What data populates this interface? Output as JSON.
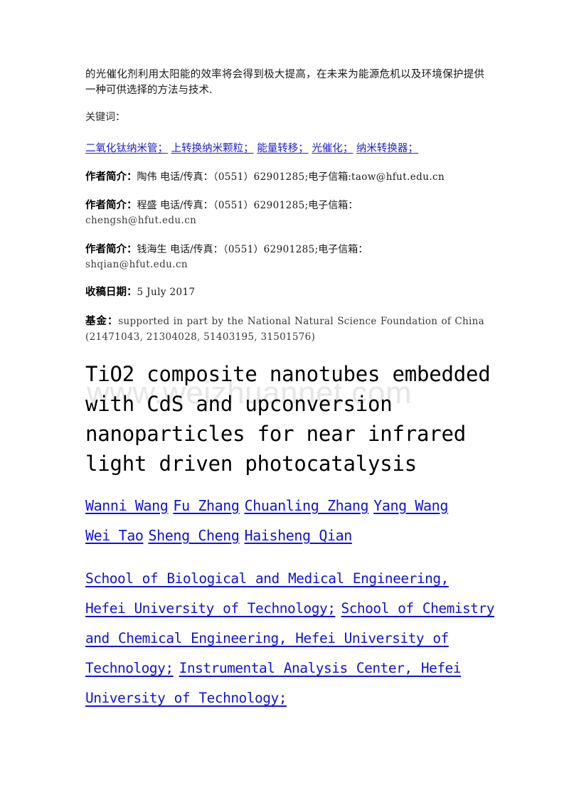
{
  "document": {
    "abstract_tail": "的光催化剂利用太阳能的效率将会得到极大提高，在未来为能源危机以及环境保护提供一种可供选择的方法与技术.",
    "keywords_label": "关键词：",
    "keywords": [
      "二氧化钛纳米管；",
      "上转换纳米颗粒；",
      "能量转移；",
      "光催化；",
      "纳米转换器；"
    ],
    "author_bios": [
      {
        "label": "作者简介：",
        "name": "陶伟",
        "contact_label": "电话/传真：",
        "phone": "（0551）62901285",
        "email_label": "电子信箱:",
        "email": "taow@hfut.edu.cn",
        "inline": true
      },
      {
        "label": "作者简介：",
        "name": "程盛",
        "contact_label": "电话/传真：",
        "phone": "（0551）62901285",
        "email_label": "电子信箱：",
        "email": "chengsh@hfut.edu.cn",
        "inline": false
      },
      {
        "label": "作者简介：",
        "name": "钱海生",
        "contact_label": "电话/传真：",
        "phone": "（0551）62901285",
        "email_label": "电子信箱：",
        "email": "shqian@hfut.edu.cn",
        "inline": false
      }
    ],
    "received": {
      "label": "收稿日期：",
      "value": "5 July 2017"
    },
    "funding": {
      "label": "基金：",
      "value": "supported in part by the National Natural Science Foundation of China (21471043, 21304028, 51403195, 31501576)"
    },
    "title": "TiO2 composite nanotubes embedded with CdS and upconversion nanoparticles for near infrared light driven photocatalysis",
    "title_lines": [
      "TiO2 composite nanotubes embedded",
      "with CdS and upconversion",
      "nanoparticles for near infrared",
      "light driven photocatalysis"
    ],
    "authors": [
      "Wanni Wang",
      "Fu Zhang",
      "Chuanling Zhang",
      "Yang Wang",
      "Wei Tao",
      "Sheng Cheng",
      "Haisheng Qian"
    ],
    "affiliations": [
      "School of Biological and Medical Engineering, Hefei University of Technology;",
      "School of Chemistry and Chemical Engineering, Hefei University of Technology;",
      "Instrumental Analysis Center, Hefei University of Technology;"
    ],
    "watermark": "www.weizhuannet.com",
    "colors": {
      "link": "#1414d2",
      "keyword_link": "#2222cc",
      "text": "#1a1a1a",
      "watermark": "#e6e6e6",
      "page_background": "#ffffff"
    }
  }
}
